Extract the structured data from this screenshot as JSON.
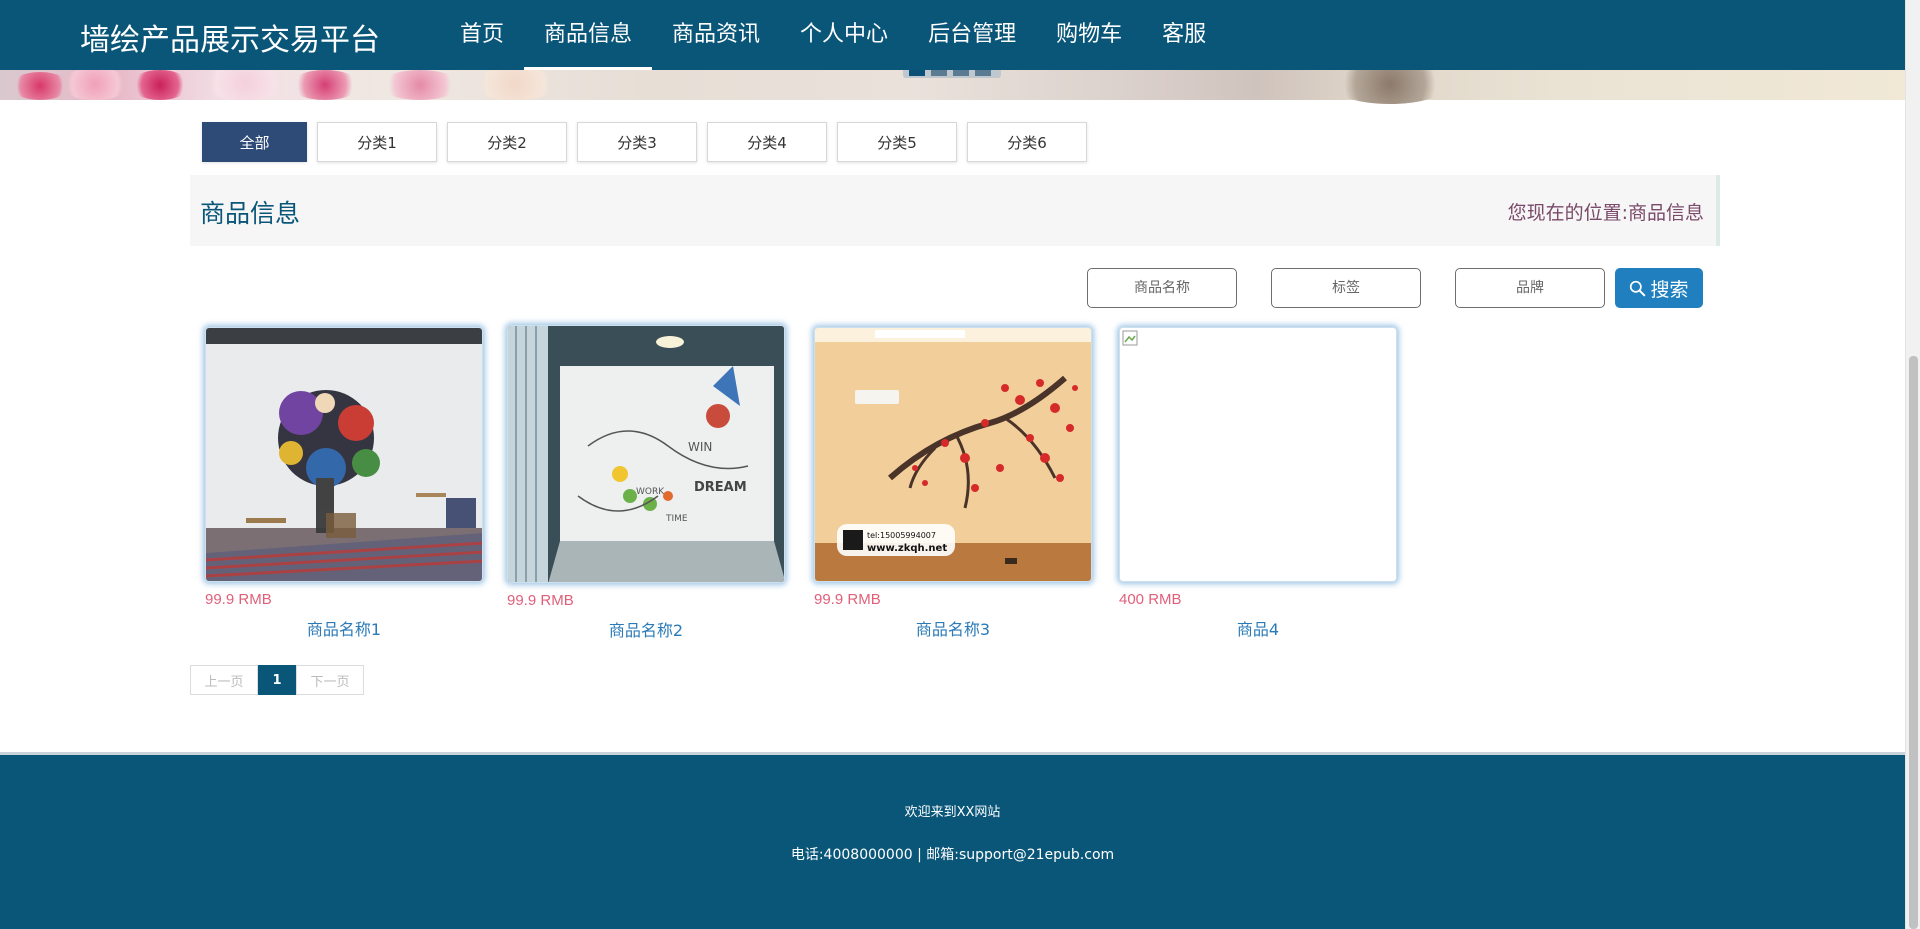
{
  "site": {
    "brand": "墙绘产品展示交易平台",
    "nav": [
      "首页",
      "商品信息",
      "商品资讯",
      "个人中心",
      "后台管理",
      "购物车",
      "客服"
    ],
    "active_nav": "商品信息"
  },
  "categories": [
    "全部",
    "分类1",
    "分类2",
    "分类3",
    "分类4",
    "分类5",
    "分类6"
  ],
  "section": {
    "title": "商品信息",
    "location_label": "您现在的位置:",
    "location_current": "商品信息"
  },
  "search": {
    "name_placeholder": "商品名称",
    "tag_placeholder": "标签",
    "brand_placeholder": "品牌",
    "button_label": "搜索"
  },
  "products": [
    {
      "price": "99.9 RMB",
      "name": "商品名称1"
    },
    {
      "price": "99.9 RMB",
      "name": "商品名称2"
    },
    {
      "price": "99.9 RMB",
      "name": "商品名称3"
    },
    {
      "price": "400 RMB",
      "name": "商品4"
    }
  ],
  "product_image_text": {
    "img2": [
      "WIN",
      "WORK",
      "DREAM",
      "TIME"
    ],
    "img3": [
      "tel:15005994007",
      "www.zkqh.net"
    ]
  },
  "pagination": {
    "prev": "上一页",
    "current": "1",
    "next": "下一页"
  },
  "footer": {
    "welcome": "欢迎来到XX网站",
    "contact": "电话:4008000000 | 邮箱:support@21epub.com"
  },
  "colors": {
    "nav_bg": "#0a5679",
    "accent_blue": "#1f7fbf",
    "price_pink": "#e0607a",
    "tab_active": "#2e4a76"
  }
}
